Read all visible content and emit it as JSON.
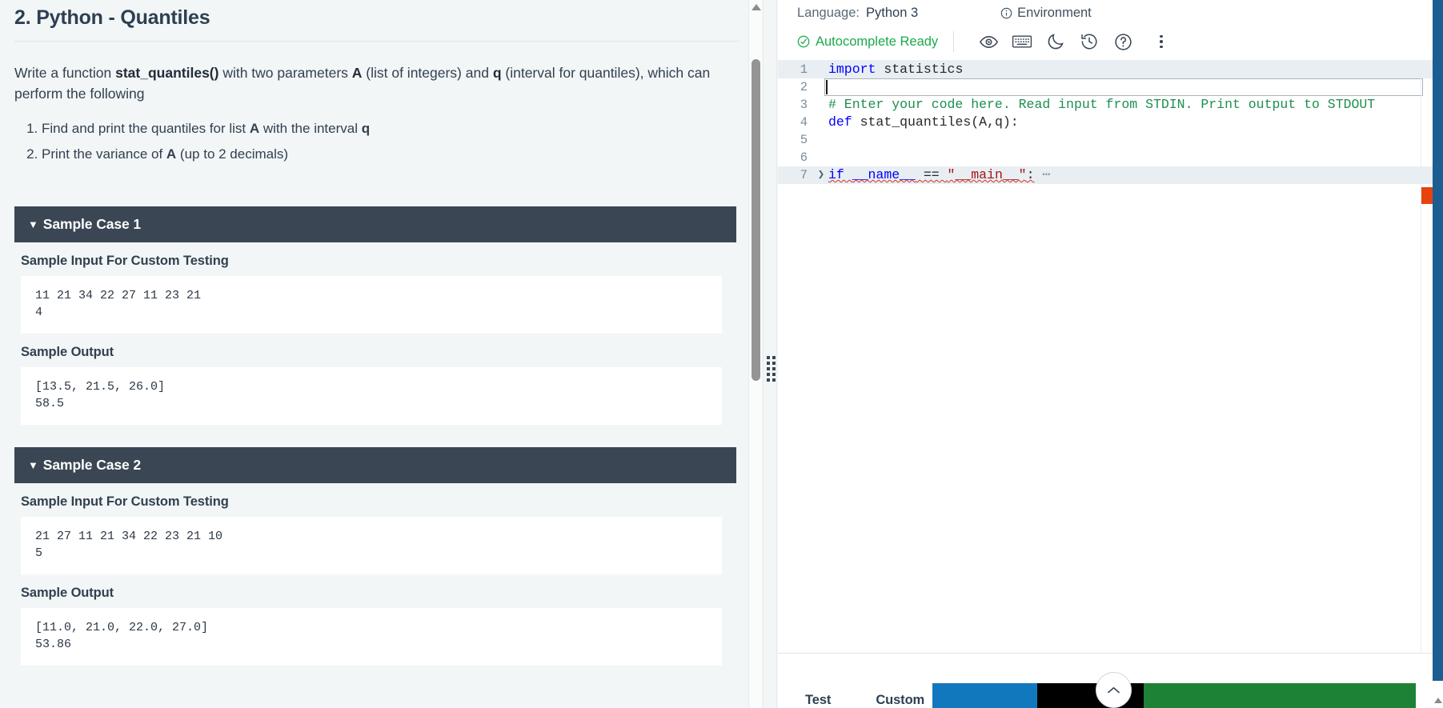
{
  "problem": {
    "title": "2. Python - Quantiles",
    "description_prefix": "Write a function ",
    "function_name": "stat_quantiles()",
    "description_mid1": " with two parameters ",
    "param_a": "A",
    "description_mid2": " (list of integers) and ",
    "param_q": "q",
    "description_suffix": " (interval for quantiles), which can perform the following",
    "requirements": [
      {
        "pre": "Find and print the quantiles for list ",
        "b1": "A",
        "mid": " with the interval ",
        "b2": "q",
        "post": ""
      },
      {
        "pre": "Print the variance of ",
        "b1": "A",
        "mid": " (up to 2 decimals)",
        "b2": "",
        "post": ""
      }
    ]
  },
  "sample_cases": [
    {
      "header": "Sample Case 1",
      "caret": "▼",
      "input_label": "Sample Input For Custom Testing",
      "input_value": "11 21 34 22 27 11 23 21\n4",
      "output_label": "Sample Output",
      "output_value": "[13.5, 21.5, 26.0]\n58.5"
    },
    {
      "header": "Sample Case 2",
      "caret": "▼",
      "input_label": "Sample Input For Custom Testing",
      "input_value": "21 27 11 21 34 22 23 21 10\n5",
      "output_label": "Sample Output",
      "output_value": "[11.0, 21.0, 22.0, 27.0]\n53.86"
    }
  ],
  "editor": {
    "language_label": "Language:",
    "language_value": "Python 3",
    "environment_label": "Environment",
    "autocomplete_label": "Autocomplete Ready",
    "toolbar_icons": [
      "eye-icon",
      "keyboard-icon",
      "moon-icon",
      "history-icon",
      "help-icon",
      "kebab-menu-icon"
    ],
    "lines": [
      {
        "num": "1",
        "fold": "",
        "segments": [
          {
            "t": "import",
            "c": "kw2"
          },
          {
            "t": " statistics",
            "c": ""
          }
        ],
        "highlight": true
      },
      {
        "num": "2",
        "fold": "",
        "segments": [
          {
            "t": "",
            "c": ""
          }
        ],
        "highlight": false
      },
      {
        "num": "3",
        "fold": "",
        "segments": [
          {
            "t": "# Enter your code here. Read input from STDIN. Print output to STDOUT",
            "c": "cmt"
          }
        ],
        "highlight": false
      },
      {
        "num": "4",
        "fold": "",
        "segments": [
          {
            "t": "def",
            "c": "kw2"
          },
          {
            "t": " stat_quantiles(A,q):",
            "c": ""
          }
        ],
        "highlight": false
      },
      {
        "num": "5",
        "fold": "",
        "segments": [
          {
            "t": "",
            "c": ""
          }
        ],
        "highlight": false
      },
      {
        "num": "6",
        "fold": "",
        "segments": [
          {
            "t": "",
            "c": ""
          }
        ],
        "highlight": false
      },
      {
        "num": "7",
        "fold": "❯",
        "segments": [
          {
            "t": "if ",
            "c": "kw2 squig"
          },
          {
            "t": "__name__",
            "c": "dunder squig"
          },
          {
            "t": " == ",
            "c": "squig"
          },
          {
            "t": "\"__main__\"",
            "c": "str squig"
          },
          {
            "t": ":",
            "c": "squig"
          },
          {
            "t": " ⋯",
            "c": "ellip"
          }
        ],
        "highlight": true
      }
    ]
  },
  "bottom_bar": {
    "tab_testcase": "Test",
    "tab_custominput": "Custom",
    "button_blue": "",
    "button_black": "",
    "button_green": "",
    "collapse_icon": "chevron-up-icon"
  },
  "colors": {
    "case_header_bg": "#3b4654",
    "accent_green": "#1ba94c",
    "error_red": "#e8430f",
    "scroll_blue": "#1c5d92",
    "run_blue": "#1278be",
    "submit_green": "#1e8236"
  }
}
